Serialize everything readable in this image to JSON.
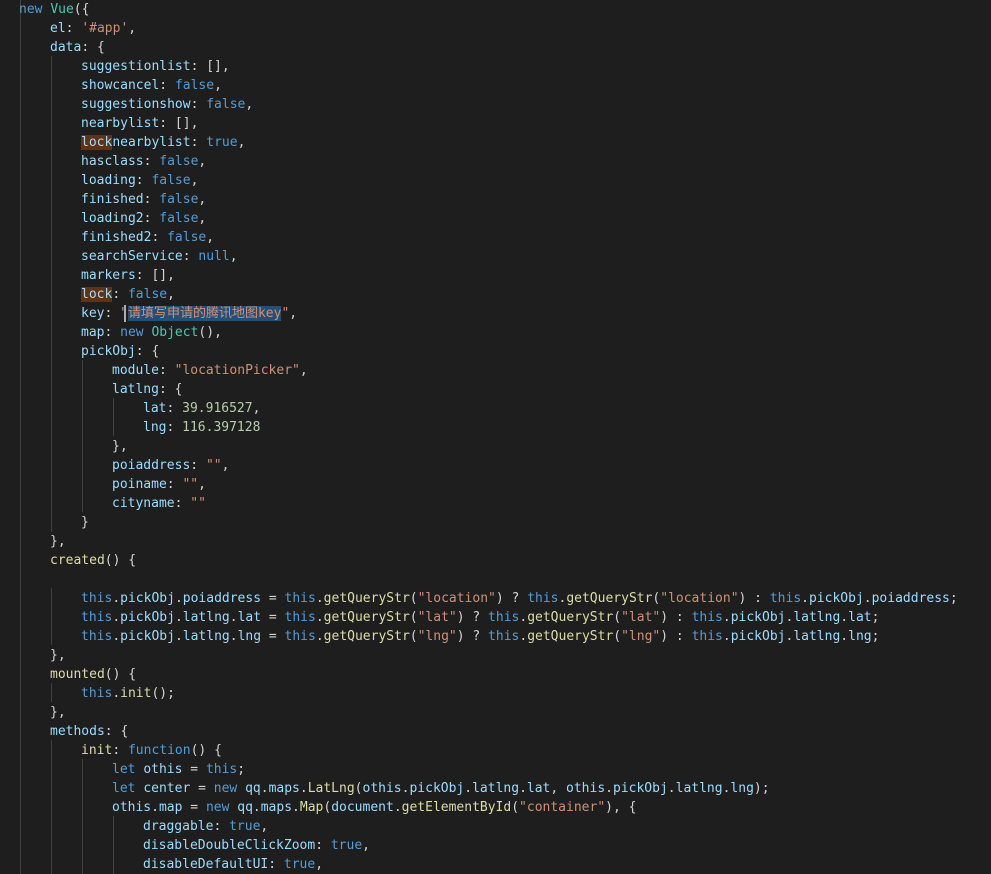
{
  "editor": {
    "lines": [
      [
        [
          "k",
          "new"
        ],
        [
          "o",
          " "
        ],
        [
          "t",
          "Vue"
        ],
        [
          "o",
          "({"
        ]
      ],
      [
        [
          "p",
          "el"
        ],
        [
          "o",
          ": "
        ],
        [
          "s",
          "'#app'"
        ],
        [
          "o",
          ","
        ]
      ],
      [
        [
          "p",
          "data"
        ],
        [
          "o",
          ": {"
        ]
      ],
      [
        [
          "p",
          "suggestionlist"
        ],
        [
          "o",
          ": [],"
        ]
      ],
      [
        [
          "p",
          "showcancel"
        ],
        [
          "o",
          ": "
        ],
        [
          "k",
          "false"
        ],
        [
          "o",
          ","
        ]
      ],
      [
        [
          "p",
          "suggestionshow"
        ],
        [
          "o",
          ": "
        ],
        [
          "k",
          "false"
        ],
        [
          "o",
          ","
        ]
      ],
      [
        [
          "p",
          "nearbylist"
        ],
        [
          "o",
          ": [],"
        ]
      ],
      [
        [
          "p",
          "lock",
          "ws"
        ],
        [
          "p",
          "nearbylist"
        ],
        [
          "o",
          ": "
        ],
        [
          "k",
          "true"
        ],
        [
          "o",
          ","
        ]
      ],
      [
        [
          "p",
          "hasclass"
        ],
        [
          "o",
          ": "
        ],
        [
          "k",
          "false"
        ],
        [
          "o",
          ","
        ]
      ],
      [
        [
          "p",
          "loading"
        ],
        [
          "o",
          ": "
        ],
        [
          "k",
          "false"
        ],
        [
          "o",
          ","
        ]
      ],
      [
        [
          "p",
          "finished"
        ],
        [
          "o",
          ": "
        ],
        [
          "k",
          "false"
        ],
        [
          "o",
          ","
        ]
      ],
      [
        [
          "p",
          "loading2"
        ],
        [
          "o",
          ": "
        ],
        [
          "k",
          "false"
        ],
        [
          "o",
          ","
        ]
      ],
      [
        [
          "p",
          "finished2"
        ],
        [
          "o",
          ": "
        ],
        [
          "k",
          "false"
        ],
        [
          "o",
          ","
        ]
      ],
      [
        [
          "p",
          "searchService"
        ],
        [
          "o",
          ": "
        ],
        [
          "k",
          "null"
        ],
        [
          "o",
          ","
        ]
      ],
      [
        [
          "p",
          "markers"
        ],
        [
          "o",
          ": [],"
        ]
      ],
      [
        [
          "p",
          "lock",
          "ws"
        ],
        [
          "o",
          ": "
        ],
        [
          "k",
          "false"
        ],
        [
          "o",
          ","
        ]
      ],
      [
        [
          "p",
          "key"
        ],
        [
          "o",
          ": "
        ],
        [
          "s",
          "\""
        ],
        [
          "s",
          "请填写申请的腾讯地图key",
          "sel"
        ],
        [
          "s",
          "\""
        ],
        [
          "o",
          ","
        ]
      ],
      [
        [
          "p",
          "map"
        ],
        [
          "o",
          ": "
        ],
        [
          "k",
          "new"
        ],
        [
          "o",
          " "
        ],
        [
          "t",
          "Object"
        ],
        [
          "o",
          "(),"
        ]
      ],
      [
        [
          "p",
          "pickObj"
        ],
        [
          "o",
          ": {"
        ]
      ],
      [
        [
          "p",
          "module"
        ],
        [
          "o",
          ": "
        ],
        [
          "s",
          "\"locationPicker\""
        ],
        [
          "o",
          ","
        ]
      ],
      [
        [
          "p",
          "latlng"
        ],
        [
          "o",
          ": {"
        ]
      ],
      [
        [
          "p",
          "lat"
        ],
        [
          "o",
          ": "
        ],
        [
          "n",
          "39.916527"
        ],
        [
          "o",
          ","
        ]
      ],
      [
        [
          "p",
          "lng"
        ],
        [
          "o",
          ": "
        ],
        [
          "n",
          "116.397128"
        ]
      ],
      [
        [
          "o",
          "},"
        ]
      ],
      [
        [
          "p",
          "poiaddress"
        ],
        [
          "o",
          ": "
        ],
        [
          "s",
          "\"\""
        ],
        [
          "o",
          ","
        ]
      ],
      [
        [
          "p",
          "poiname"
        ],
        [
          "o",
          ": "
        ],
        [
          "s",
          "\"\""
        ],
        [
          "o",
          ","
        ]
      ],
      [
        [
          "p",
          "cityname"
        ],
        [
          "o",
          ": "
        ],
        [
          "s",
          "\"\""
        ]
      ],
      [
        [
          "o",
          "}"
        ]
      ],
      [
        [
          "o",
          "},"
        ]
      ],
      [
        [
          "f",
          "created"
        ],
        [
          "o",
          "() {"
        ]
      ],
      [
        [
          "o",
          ""
        ]
      ],
      [
        [
          "k",
          "this"
        ],
        [
          "o",
          "."
        ],
        [
          "p",
          "pickObj"
        ],
        [
          "o",
          "."
        ],
        [
          "p",
          "poiaddress"
        ],
        [
          "o",
          " = "
        ],
        [
          "k",
          "this"
        ],
        [
          "o",
          "."
        ],
        [
          "f",
          "getQueryStr"
        ],
        [
          "o",
          "("
        ],
        [
          "s",
          "\"location\""
        ],
        [
          "o",
          ") ? "
        ],
        [
          "k",
          "this"
        ],
        [
          "o",
          "."
        ],
        [
          "f",
          "getQueryStr"
        ],
        [
          "o",
          "("
        ],
        [
          "s",
          "\"location\""
        ],
        [
          "o",
          ") : "
        ],
        [
          "k",
          "this"
        ],
        [
          "o",
          "."
        ],
        [
          "p",
          "pickObj"
        ],
        [
          "o",
          "."
        ],
        [
          "p",
          "poiaddress"
        ],
        [
          "o",
          ";"
        ]
      ],
      [
        [
          "k",
          "this"
        ],
        [
          "o",
          "."
        ],
        [
          "p",
          "pickObj"
        ],
        [
          "o",
          "."
        ],
        [
          "p",
          "latlng"
        ],
        [
          "o",
          "."
        ],
        [
          "p",
          "lat"
        ],
        [
          "o",
          " = "
        ],
        [
          "k",
          "this"
        ],
        [
          "o",
          "."
        ],
        [
          "f",
          "getQueryStr"
        ],
        [
          "o",
          "("
        ],
        [
          "s",
          "\"lat\""
        ],
        [
          "o",
          ") ? "
        ],
        [
          "k",
          "this"
        ],
        [
          "o",
          "."
        ],
        [
          "f",
          "getQueryStr"
        ],
        [
          "o",
          "("
        ],
        [
          "s",
          "\"lat\""
        ],
        [
          "o",
          ") : "
        ],
        [
          "k",
          "this"
        ],
        [
          "o",
          "."
        ],
        [
          "p",
          "pickObj"
        ],
        [
          "o",
          "."
        ],
        [
          "p",
          "latlng"
        ],
        [
          "o",
          "."
        ],
        [
          "p",
          "lat"
        ],
        [
          "o",
          ";"
        ]
      ],
      [
        [
          "k",
          "this"
        ],
        [
          "o",
          "."
        ],
        [
          "p",
          "pickObj"
        ],
        [
          "o",
          "."
        ],
        [
          "p",
          "latlng"
        ],
        [
          "o",
          "."
        ],
        [
          "p",
          "lng"
        ],
        [
          "o",
          " = "
        ],
        [
          "k",
          "this"
        ],
        [
          "o",
          "."
        ],
        [
          "f",
          "getQueryStr"
        ],
        [
          "o",
          "("
        ],
        [
          "s",
          "\"lng\""
        ],
        [
          "o",
          ") ? "
        ],
        [
          "k",
          "this"
        ],
        [
          "o",
          "."
        ],
        [
          "f",
          "getQueryStr"
        ],
        [
          "o",
          "("
        ],
        [
          "s",
          "\"lng\""
        ],
        [
          "o",
          ") : "
        ],
        [
          "k",
          "this"
        ],
        [
          "o",
          "."
        ],
        [
          "p",
          "pickObj"
        ],
        [
          "o",
          "."
        ],
        [
          "p",
          "latlng"
        ],
        [
          "o",
          "."
        ],
        [
          "p",
          "lng"
        ],
        [
          "o",
          ";"
        ]
      ],
      [
        [
          "o",
          "},"
        ]
      ],
      [
        [
          "f",
          "mounted"
        ],
        [
          "o",
          "() {"
        ]
      ],
      [
        [
          "k",
          "this"
        ],
        [
          "o",
          "."
        ],
        [
          "f",
          "init"
        ],
        [
          "o",
          "();"
        ]
      ],
      [
        [
          "o",
          "},"
        ]
      ],
      [
        [
          "p",
          "methods"
        ],
        [
          "o",
          ": {"
        ]
      ],
      [
        [
          "f",
          "init"
        ],
        [
          "o",
          ": "
        ],
        [
          "k",
          "function"
        ],
        [
          "o",
          "() {"
        ]
      ],
      [
        [
          "k",
          "let"
        ],
        [
          "o",
          " "
        ],
        [
          "p",
          "othis"
        ],
        [
          "o",
          " = "
        ],
        [
          "k",
          "this"
        ],
        [
          "o",
          ";"
        ]
      ],
      [
        [
          "k",
          "let"
        ],
        [
          "o",
          " "
        ],
        [
          "p",
          "center"
        ],
        [
          "o",
          " = "
        ],
        [
          "k",
          "new"
        ],
        [
          "o",
          " "
        ],
        [
          "p",
          "qq"
        ],
        [
          "o",
          "."
        ],
        [
          "p",
          "maps"
        ],
        [
          "o",
          "."
        ],
        [
          "f",
          "LatLng"
        ],
        [
          "o",
          "("
        ],
        [
          "p",
          "othis"
        ],
        [
          "o",
          "."
        ],
        [
          "p",
          "pickObj"
        ],
        [
          "o",
          "."
        ],
        [
          "p",
          "latlng"
        ],
        [
          "o",
          "."
        ],
        [
          "p",
          "lat"
        ],
        [
          "o",
          ", "
        ],
        [
          "p",
          "othis"
        ],
        [
          "o",
          "."
        ],
        [
          "p",
          "pickObj"
        ],
        [
          "o",
          "."
        ],
        [
          "p",
          "latlng"
        ],
        [
          "o",
          "."
        ],
        [
          "p",
          "lng"
        ],
        [
          "o",
          ");"
        ]
      ],
      [
        [
          "p",
          "othis"
        ],
        [
          "o",
          "."
        ],
        [
          "p",
          "map"
        ],
        [
          "o",
          " = "
        ],
        [
          "k",
          "new"
        ],
        [
          "o",
          " "
        ],
        [
          "p",
          "qq"
        ],
        [
          "o",
          "."
        ],
        [
          "p",
          "maps"
        ],
        [
          "o",
          "."
        ],
        [
          "f",
          "Map"
        ],
        [
          "o",
          "("
        ],
        [
          "p",
          "document"
        ],
        [
          "o",
          "."
        ],
        [
          "f",
          "getElementById"
        ],
        [
          "o",
          "("
        ],
        [
          "s",
          "\"container\""
        ],
        [
          "o",
          "), {"
        ]
      ],
      [
        [
          "p",
          "draggable"
        ],
        [
          "o",
          ": "
        ],
        [
          "k",
          "true"
        ],
        [
          "o",
          ","
        ]
      ],
      [
        [
          "p",
          "disableDoubleClickZoom"
        ],
        [
          "o",
          ": "
        ],
        [
          "k",
          "true"
        ],
        [
          "o",
          ","
        ]
      ],
      [
        [
          "p",
          "disableDefaultUI"
        ],
        [
          "o",
          ": "
        ],
        [
          "k",
          "true"
        ],
        [
          "o",
          ","
        ]
      ]
    ]
  }
}
